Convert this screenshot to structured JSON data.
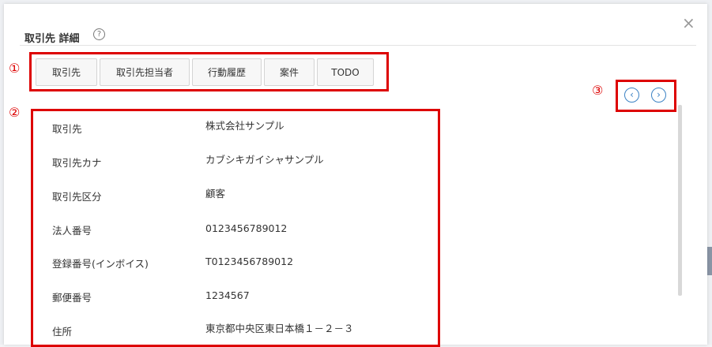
{
  "modal": {
    "title": "取引先 詳細",
    "help_symbol": "?",
    "close_symbol": "×"
  },
  "markers": {
    "tabs": "①",
    "details": "②",
    "nav": "③"
  },
  "tabs": [
    {
      "label": "取引先"
    },
    {
      "label": "取引先担当者"
    },
    {
      "label": "行動履歴"
    },
    {
      "label": "案件"
    },
    {
      "label": "TODO"
    }
  ],
  "nav": {
    "prev_symbol": "‹",
    "next_symbol": "›"
  },
  "fields": [
    {
      "label": "取引先",
      "value": "株式会社サンプル"
    },
    {
      "label": "取引先カナ",
      "value": "カブシキガイシャサンプル"
    },
    {
      "label": "取引先区分",
      "value": "顧客"
    },
    {
      "label": "法人番号",
      "value": "0123456789012"
    },
    {
      "label": "登録番号(インボイス)",
      "value": "T0123456789012"
    },
    {
      "label": "郵便番号",
      "value": "1234567"
    },
    {
      "label": "住所",
      "value": "東京都中央区東日本橋１－２－３"
    }
  ]
}
